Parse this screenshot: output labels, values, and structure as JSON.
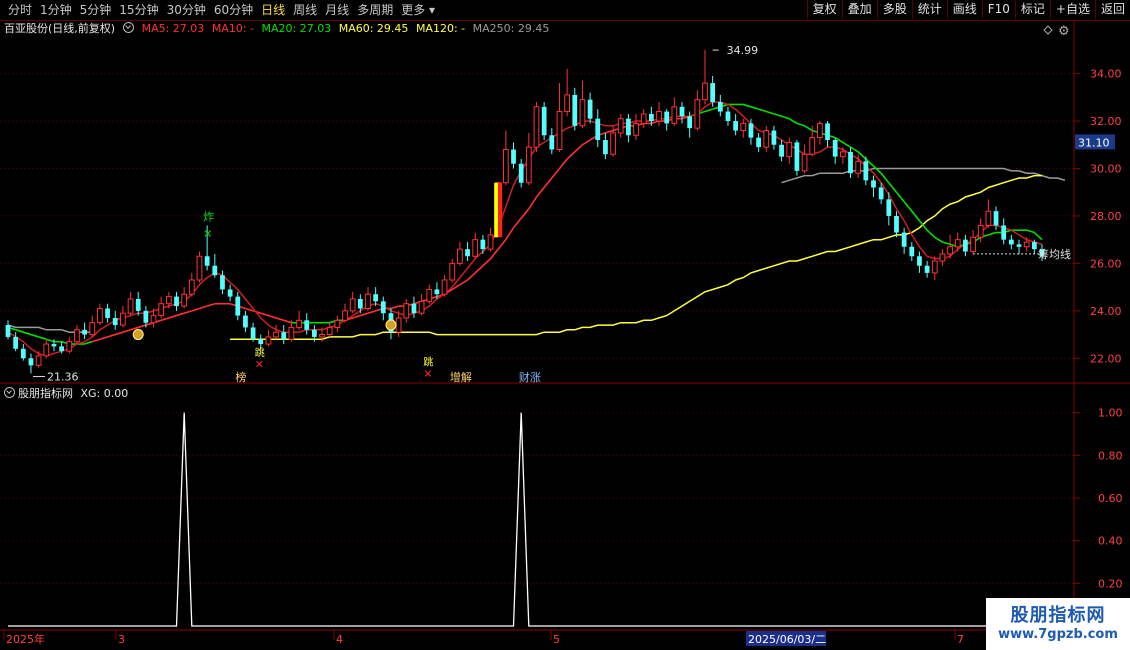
{
  "toolbar": {
    "periods": [
      "分时",
      "1分钟",
      "5分钟",
      "15分钟",
      "30分钟",
      "60分钟",
      "日线",
      "周线",
      "月线",
      "多周期",
      "更多"
    ],
    "active_period": "日线",
    "buttons": [
      "复权",
      "叠加",
      "多股",
      "统计",
      "画线",
      "F10",
      "标记",
      "+自选",
      "返回"
    ]
  },
  "info": {
    "title": "百亚股份(日线,前复权)",
    "ma5": "MA5: 27.03",
    "ma10": "MA10: -",
    "ma20": "MA20: 27.03",
    "ma60": "MA60: 29.45",
    "ma120": "MA120: -",
    "ma250": "MA250: 29.45"
  },
  "sub_info": {
    "name": "股朋指标网",
    "xg": "XG: 0.00"
  },
  "colors": {
    "up": "#ff3232",
    "down": "#54ffff",
    "ma5": "#ff3030",
    "ma20": "#00e000",
    "ma60": "#ffff40",
    "ma250": "#9a9a9a",
    "axis_red": "#8b0000"
  },
  "chart_data": {
    "type": "candlestick",
    "price_axis": {
      "ticks": [
        "34.00",
        "32.00",
        "30.00",
        "28.00",
        "26.00",
        "24.00",
        "22.00"
      ],
      "range": [
        21.0,
        35.5
      ]
    },
    "current_price_tag": "31.10",
    "high_label": "34.99",
    "low_label": "21.36",
    "line_label": "筹均线",
    "x_labels": [
      "2025年",
      "3",
      "4",
      "5",
      "2025/06/03/二",
      "7"
    ],
    "candles": [
      [
        23.4,
        22.9,
        23.6,
        22.8
      ],
      [
        22.9,
        22.4,
        23.1,
        22.3
      ],
      [
        22.4,
        22.0,
        22.6,
        21.9
      ],
      [
        22.0,
        21.7,
        22.2,
        21.36
      ],
      [
        21.7,
        22.1,
        22.3,
        21.6
      ],
      [
        22.1,
        22.6,
        22.8,
        22.0
      ],
      [
        22.6,
        22.5,
        22.8,
        22.3
      ],
      [
        22.5,
        22.3,
        22.7,
        22.2
      ],
      [
        22.3,
        22.7,
        22.9,
        22.2
      ],
      [
        22.7,
        23.2,
        23.4,
        22.6
      ],
      [
        23.2,
        23.0,
        23.5,
        22.8
      ],
      [
        23.0,
        23.5,
        23.8,
        22.9
      ],
      [
        23.5,
        24.1,
        24.3,
        23.4
      ],
      [
        24.1,
        23.7,
        24.3,
        23.5
      ],
      [
        23.7,
        23.4,
        24.0,
        23.2
      ],
      [
        23.4,
        23.9,
        24.2,
        23.3
      ],
      [
        23.9,
        24.5,
        24.8,
        23.8
      ],
      [
        24.5,
        24.0,
        24.8,
        23.8
      ],
      [
        24.0,
        23.5,
        24.2,
        23.3
      ],
      [
        23.5,
        23.8,
        24.1,
        23.3
      ],
      [
        23.8,
        24.3,
        24.6,
        23.7
      ],
      [
        24.3,
        24.6,
        24.8,
        24.1
      ],
      [
        24.6,
        24.2,
        24.8,
        24.0
      ],
      [
        24.2,
        24.7,
        25.0,
        24.1
      ],
      [
        24.7,
        25.3,
        25.6,
        24.6
      ],
      [
        25.3,
        26.3,
        26.5,
        25.2
      ],
      [
        26.3,
        25.9,
        27.6,
        25.7
      ],
      [
        25.9,
        25.5,
        26.4,
        25.4
      ],
      [
        25.5,
        24.9,
        25.7,
        24.7
      ],
      [
        24.9,
        24.6,
        25.1,
        24.4
      ],
      [
        24.6,
        23.8,
        24.8,
        23.6
      ],
      [
        23.8,
        23.3,
        24.0,
        23.1
      ],
      [
        23.3,
        22.8,
        23.5,
        22.7
      ],
      [
        22.8,
        22.6,
        23.0,
        22.4
      ],
      [
        22.6,
        22.9,
        23.2,
        22.5
      ],
      [
        22.9,
        23.1,
        23.4,
        22.8
      ],
      [
        23.1,
        22.8,
        23.4,
        22.6
      ],
      [
        22.8,
        23.3,
        23.6,
        22.7
      ],
      [
        23.3,
        23.6,
        24.0,
        23.2
      ],
      [
        23.6,
        23.2,
        23.9,
        23.0
      ],
      [
        23.2,
        22.9,
        23.4,
        22.7
      ],
      [
        22.9,
        23.0,
        23.3,
        22.7
      ],
      [
        23.0,
        23.3,
        23.5,
        22.9
      ],
      [
        23.3,
        23.6,
        23.8,
        23.1
      ],
      [
        23.6,
        24.0,
        24.3,
        23.5
      ],
      [
        24.0,
        24.5,
        24.8,
        23.9
      ],
      [
        24.5,
        24.1,
        24.7,
        23.9
      ],
      [
        24.1,
        24.7,
        25.0,
        24.0
      ],
      [
        24.7,
        24.4,
        25.0,
        24.2
      ],
      [
        24.4,
        23.9,
        24.6,
        23.6
      ],
      [
        23.9,
        23.1,
        24.1,
        22.8
      ],
      [
        23.1,
        23.7,
        24.0,
        22.9
      ],
      [
        23.7,
        24.3,
        24.5,
        23.5
      ],
      [
        24.3,
        23.9,
        24.6,
        23.7
      ],
      [
        23.9,
        24.4,
        24.7,
        23.8
      ],
      [
        24.4,
        24.9,
        25.1,
        24.3
      ],
      [
        24.9,
        24.7,
        25.2,
        24.5
      ],
      [
        24.7,
        25.3,
        25.5,
        24.6
      ],
      [
        25.3,
        26.0,
        26.2,
        25.2
      ],
      [
        26.0,
        26.6,
        26.9,
        25.9
      ],
      [
        26.6,
        26.3,
        26.9,
        26.1
      ],
      [
        26.3,
        27.0,
        27.3,
        26.2
      ],
      [
        27.0,
        26.6,
        27.2,
        26.4
      ],
      [
        26.6,
        27.2,
        27.5,
        26.5
      ],
      [
        27.2,
        29.4,
        29.4,
        27.1
      ],
      [
        29.4,
        30.8,
        31.6,
        29.3
      ],
      [
        30.8,
        30.2,
        31.1,
        30.0
      ],
      [
        30.2,
        29.4,
        30.4,
        29.2
      ],
      [
        29.4,
        30.9,
        31.5,
        29.3
      ],
      [
        30.9,
        32.6,
        32.8,
        30.7
      ],
      [
        32.6,
        31.4,
        32.8,
        31.2
      ],
      [
        31.4,
        30.8,
        31.7,
        30.6
      ],
      [
        30.8,
        32.4,
        33.6,
        30.7
      ],
      [
        32.4,
        33.1,
        34.2,
        32.2
      ],
      [
        33.1,
        31.8,
        33.4,
        31.6
      ],
      [
        31.8,
        32.9,
        33.7,
        31.7
      ],
      [
        32.9,
        32.1,
        33.2,
        31.9
      ],
      [
        32.1,
        31.2,
        32.5,
        30.9
      ],
      [
        31.2,
        30.6,
        31.5,
        30.4
      ],
      [
        30.6,
        31.5,
        31.8,
        30.5
      ],
      [
        31.5,
        32.1,
        32.3,
        31.3
      ],
      [
        32.1,
        31.4,
        32.3,
        31.1
      ],
      [
        31.4,
        31.9,
        32.3,
        31.2
      ],
      [
        31.9,
        32.3,
        32.5,
        31.7
      ],
      [
        32.3,
        32.0,
        32.6,
        31.8
      ],
      [
        32.0,
        32.4,
        32.8,
        31.8
      ],
      [
        32.4,
        31.9,
        32.5,
        31.6
      ],
      [
        31.9,
        32.6,
        33.0,
        31.8
      ],
      [
        32.6,
        32.2,
        32.8,
        31.9
      ],
      [
        32.2,
        31.7,
        32.4,
        31.3
      ],
      [
        31.7,
        32.9,
        33.3,
        31.6
      ],
      [
        32.9,
        33.6,
        34.99,
        32.7
      ],
      [
        33.6,
        32.8,
        33.9,
        32.6
      ],
      [
        32.8,
        32.4,
        33.1,
        32.2
      ],
      [
        32.4,
        32.0,
        32.6,
        31.8
      ],
      [
        32.0,
        31.6,
        32.3,
        31.4
      ],
      [
        31.6,
        31.9,
        32.1,
        31.3
      ],
      [
        31.9,
        31.3,
        32.1,
        31.0
      ],
      [
        31.3,
        30.9,
        31.5,
        30.7
      ],
      [
        30.9,
        31.6,
        31.8,
        30.7
      ],
      [
        31.6,
        31.0,
        31.8,
        30.8
      ],
      [
        31.0,
        30.5,
        31.2,
        30.3
      ],
      [
        30.5,
        31.1,
        31.3,
        30.2
      ],
      [
        31.1,
        29.9,
        31.2,
        29.7
      ],
      [
        29.9,
        30.6,
        31.0,
        29.8
      ],
      [
        30.6,
        31.3,
        31.8,
        30.5
      ],
      [
        31.3,
        31.9,
        32.0,
        31.0
      ],
      [
        31.9,
        31.2,
        32.0,
        30.9
      ],
      [
        31.2,
        30.5,
        31.3,
        30.2
      ],
      [
        30.5,
        30.7,
        30.9,
        30.2
      ],
      [
        30.7,
        29.8,
        30.9,
        29.6
      ],
      [
        29.8,
        30.3,
        30.6,
        29.6
      ],
      [
        30.3,
        29.5,
        30.5,
        29.3
      ],
      [
        29.5,
        29.2,
        29.7,
        28.8
      ],
      [
        29.2,
        28.7,
        29.4,
        28.5
      ],
      [
        28.7,
        28.0,
        29.0,
        27.6
      ],
      [
        28.0,
        27.3,
        28.2,
        27.1
      ],
      [
        27.3,
        26.7,
        27.5,
        26.4
      ],
      [
        26.7,
        26.3,
        26.9,
        26.1
      ],
      [
        26.3,
        25.9,
        26.5,
        25.6
      ],
      [
        25.9,
        25.6,
        26.1,
        25.4
      ],
      [
        25.6,
        26.1,
        26.3,
        25.3
      ],
      [
        26.1,
        26.4,
        26.6,
        25.9
      ],
      [
        26.4,
        26.7,
        27.2,
        26.2
      ],
      [
        26.7,
        27.0,
        27.3,
        26.5
      ],
      [
        27.0,
        26.5,
        27.2,
        26.3
      ],
      [
        26.5,
        27.1,
        27.4,
        26.4
      ],
      [
        27.1,
        27.6,
        27.9,
        26.9
      ],
      [
        27.6,
        28.2,
        28.7,
        27.5
      ],
      [
        28.2,
        27.6,
        28.4,
        27.4
      ],
      [
        27.6,
        27.0,
        27.9,
        26.8
      ],
      [
        27.0,
        26.8,
        27.2,
        26.6
      ],
      [
        26.8,
        26.7,
        27.0,
        26.4
      ],
      [
        26.7,
        26.9,
        27.1,
        26.5
      ],
      [
        26.9,
        26.6,
        27.0,
        26.4
      ],
      [
        26.6,
        26.3,
        26.8,
        26.1
      ]
    ],
    "ma5": [
      23.1,
      22.9,
      22.7,
      22.4,
      22.2,
      22.1,
      22.2,
      22.3,
      22.4,
      22.6,
      22.7,
      22.9,
      23.2,
      23.4,
      23.6,
      23.7,
      23.8,
      23.9,
      23.9,
      24.0,
      24.1,
      24.2,
      24.3,
      24.4,
      24.7,
      25.1,
      25.4,
      25.6,
      25.5,
      25.2,
      24.9,
      24.5,
      24.1,
      23.7,
      23.4,
      23.2,
      23.1,
      23.1,
      23.1,
      23.2,
      23.2,
      23.2,
      23.3,
      23.4,
      23.6,
      23.8,
      24.0,
      24.2,
      24.3,
      24.2,
      24.0,
      23.9,
      23.8,
      23.9,
      24.0,
      24.2,
      24.5,
      24.7,
      25.0,
      25.4,
      25.8,
      26.2,
      26.5,
      26.8,
      27.5,
      28.4,
      29.3,
      29.9,
      30.4,
      30.9,
      31.1,
      31.3,
      31.5,
      31.7,
      31.8,
      32.0,
      32.0,
      31.9,
      31.8,
      31.8,
      31.9,
      31.9,
      32.0,
      32.0,
      32.0,
      32.1,
      32.1,
      32.2,
      32.2,
      32.2,
      32.3,
      32.6,
      32.8,
      32.8,
      32.7,
      32.5,
      32.2,
      31.9,
      31.6,
      31.5,
      31.4,
      31.2,
      31.0,
      30.8,
      30.6,
      30.6,
      30.7,
      30.9,
      30.9,
      30.8,
      30.6,
      30.4,
      30.1,
      29.8,
      29.4,
      28.9,
      28.3,
      27.8,
      27.2,
      26.7,
      26.3,
      26.2,
      26.2,
      26.3,
      26.6,
      26.8,
      27.0,
      27.3,
      27.6,
      27.6,
      27.5,
      27.4,
      27.2,
      27.0,
      26.9,
      26.8
    ],
    "ma20": [
      23.3,
      23.2,
      23.1,
      23.0,
      22.9,
      22.8,
      22.7,
      22.7,
      22.6,
      22.6,
      22.6,
      22.7,
      22.8,
      22.9,
      23.0,
      23.1,
      23.2,
      23.3,
      23.4,
      23.5,
      23.6,
      23.7,
      23.8,
      23.9,
      24.0,
      24.1,
      24.2,
      24.3,
      24.3,
      24.3,
      24.2,
      24.1,
      24.0,
      23.9,
      23.8,
      23.7,
      23.6,
      23.5,
      23.5,
      23.5,
      23.5,
      23.5,
      23.5,
      23.6,
      23.6,
      23.7,
      23.8,
      23.9,
      24.0,
      24.1,
      24.1,
      24.2,
      24.2,
      24.3,
      24.4,
      24.5,
      24.6,
      24.7,
      24.9,
      25.1,
      25.3,
      25.6,
      25.9,
      26.2,
      26.6,
      27.0,
      27.5,
      27.9,
      28.3,
      28.8,
      29.2,
      29.6,
      30.0,
      30.4,
      30.7,
      31.0,
      31.2,
      31.4,
      31.5,
      31.6,
      31.7,
      31.8,
      31.8,
      31.9,
      31.9,
      32.0,
      32.0,
      32.1,
      32.1,
      32.2,
      32.3,
      32.4,
      32.5,
      32.6,
      32.7,
      32.7,
      32.7,
      32.6,
      32.5,
      32.4,
      32.3,
      32.2,
      32.1,
      31.9,
      31.8,
      31.6,
      31.5,
      31.4,
      31.3,
      31.1,
      30.9,
      30.7,
      30.4,
      30.1,
      29.8,
      29.4,
      29.0,
      28.6,
      28.2,
      27.8,
      27.4,
      27.1,
      26.9,
      26.8,
      26.7,
      26.8,
      26.9,
      27.1,
      27.2,
      27.3,
      27.3,
      27.4,
      27.4,
      27.4,
      27.3,
      27.0
    ],
    "ma20_green_segments": [
      [
        0,
        12
      ],
      [
        38,
        45
      ],
      [
        90,
        138
      ]
    ],
    "ma60": [
      22.8,
      22.8,
      22.8,
      22.8,
      22.8,
      22.8,
      22.8,
      22.8,
      22.8,
      22.8,
      22.8,
      22.8,
      22.8,
      22.9,
      22.9,
      22.9,
      22.9,
      23.0,
      23.0,
      23.0,
      23.1,
      23.1,
      23.1,
      23.1,
      23.1,
      23.1,
      23.1,
      23.0,
      23.0,
      23.0,
      23.0,
      23.0,
      23.0,
      23.0,
      23.0,
      23.0,
      23.0,
      23.0,
      23.0,
      23.0,
      23.0,
      23.1,
      23.1,
      23.1,
      23.2,
      23.2,
      23.3,
      23.3,
      23.4,
      23.4,
      23.4,
      23.5,
      23.5,
      23.5,
      23.6,
      23.6,
      23.7,
      23.8,
      24.0,
      24.2,
      24.4,
      24.6,
      24.8,
      24.9,
      25.0,
      25.1,
      25.3,
      25.4,
      25.6,
      25.7,
      25.8,
      25.9,
      26.0,
      26.1,
      26.1,
      26.2,
      26.3,
      26.4,
      26.5,
      26.5,
      26.6,
      26.7,
      26.8,
      26.9,
      27.0,
      27.0,
      27.1,
      27.2,
      27.2,
      27.3,
      27.5,
      27.8,
      28.0,
      28.3,
      28.5,
      28.6,
      28.8,
      28.9,
      29.0,
      29.2,
      29.3,
      29.4,
      29.5,
      29.6,
      29.6,
      29.7,
      29.7
    ],
    "ma250": [
      23.4,
      23.3,
      23.3,
      23.3,
      23.3,
      23.2,
      23.2,
      23.2,
      23.1,
      23.1,
      23.1,
      23.1
    ],
    "ma250_tail": [
      29.4,
      29.5,
      29.6,
      29.7,
      29.7,
      29.8,
      29.8,
      29.8,
      29.8,
      29.9,
      29.9,
      29.9,
      30.0,
      30.0,
      30.0,
      30.0,
      30.0,
      30.0,
      30.0,
      30.0,
      30.0,
      30.0,
      30.0,
      30.0,
      30.0,
      30.0,
      30.0,
      30.0,
      30.0,
      30.0,
      29.9,
      29.9,
      29.8,
      29.8,
      29.7,
      29.6,
      29.6,
      29.5
    ],
    "markers": [
      {
        "text": "炸",
        "color": "#00e000"
      },
      {
        "text": "跳",
        "color": "#ffff40"
      },
      {
        "text": "跳",
        "color": "#ffff40"
      },
      {
        "text": "榜",
        "color": "#ffd060"
      },
      {
        "text": "增解",
        "color": "#ffd060"
      },
      {
        "text": "财涨",
        "color": "#7fb8ff"
      }
    ],
    "sub_chart": {
      "type": "line",
      "y_ticks": [
        "1.00",
        "0.80",
        "0.60",
        "0.40",
        "0.20"
      ],
      "range": [
        0,
        1.05
      ],
      "spikes_at_index": [
        23,
        67
      ],
      "value": 0.0
    }
  }
}
